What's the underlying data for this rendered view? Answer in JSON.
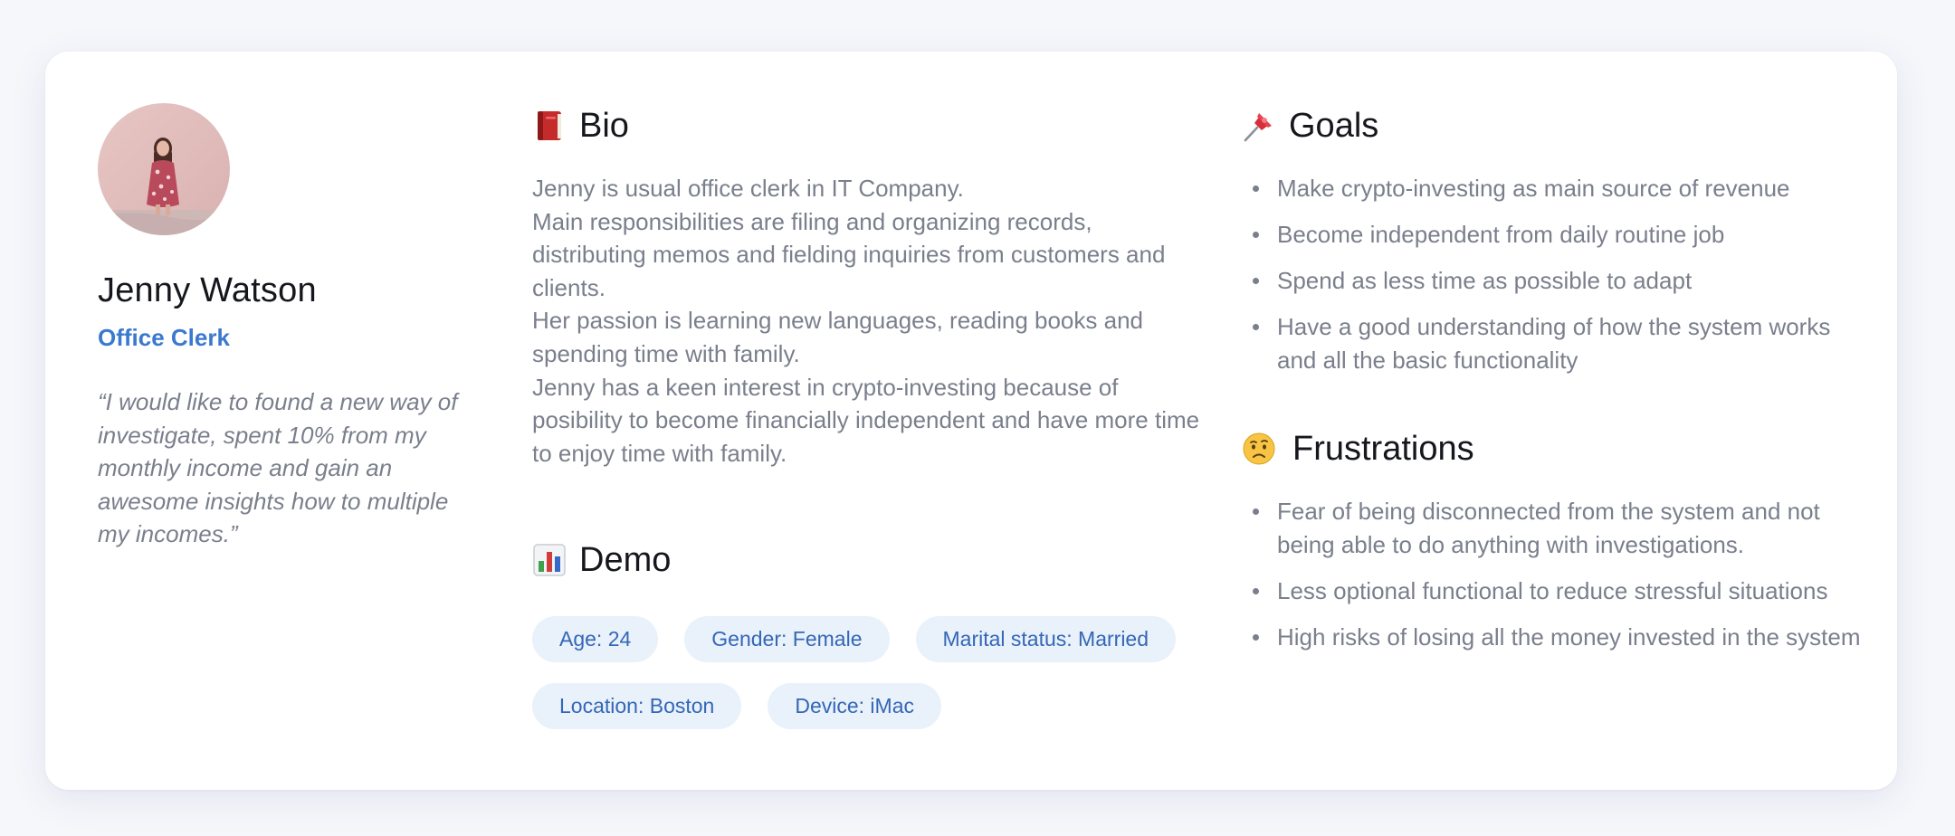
{
  "profile": {
    "name": "Jenny Watson",
    "role": "Office Clerk",
    "quote": "“I would like to found a new way of investigate, spent 10% from my monthly income and gain an awesome insights how to multiple my incomes.”",
    "avatar_icon": "person-photo"
  },
  "bio": {
    "title": "Bio",
    "icon": "book-icon",
    "lines": [
      "Jenny is usual office clerk in IT Company.",
      "Main responsibilities are filing and organizing records, distributing memos and fielding inquiries from customers and clients.",
      "Her passion is learning new languages, reading books and spending time with family.",
      "Jenny has a keen interest in crypto-investing because of posibility to become financially independent and have more time to enjoy time with family."
    ]
  },
  "demo": {
    "title": "Demo",
    "icon": "bar-chart-icon",
    "chips": [
      "Age: 24",
      "Gender: Female",
      "Marital status: Married",
      "Location: Boston",
      "Device: iMac"
    ]
  },
  "goals": {
    "title": "Goals",
    "icon": "pushpin-icon",
    "items": [
      "Make crypto-investing as main source of revenue",
      "Become independent from daily routine job",
      "Spend as less time as possible to adapt",
      "Have a good understanding of how the system works and all the basic functionality"
    ]
  },
  "frustrations": {
    "title": "Frustrations",
    "icon": "worried-face-icon",
    "items": [
      "Fear of being disconnected from the system and not being able to do anything with investigations.",
      "Less optional functional to reduce stressful situations",
      "High risks of losing all the money invested in the system"
    ]
  },
  "colors": {
    "background": "#f6f7fb",
    "card": "#ffffff",
    "accent": "#3a79cf",
    "chip_background": "#e9f1fb",
    "chip_text": "#3467b6",
    "body_text": "#7a7f8c",
    "heading_text": "#15171c"
  }
}
